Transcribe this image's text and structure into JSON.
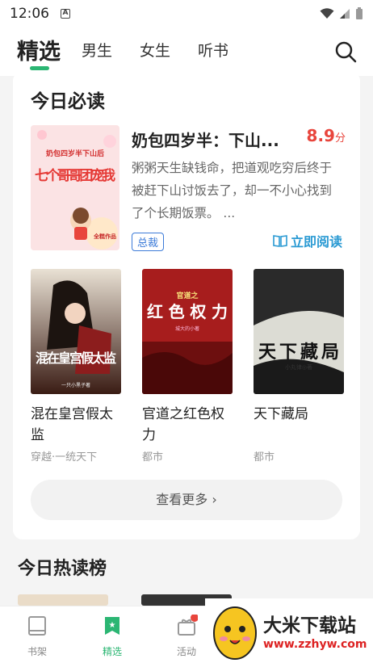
{
  "status_bar": {
    "time": "12:06",
    "a_label": "A"
  },
  "tabs": {
    "items": [
      {
        "label": "精选"
      },
      {
        "label": "男生"
      },
      {
        "label": "女生"
      },
      {
        "label": "听书"
      }
    ]
  },
  "today": {
    "title": "今日必读",
    "feature": {
      "title": "奶包四岁半：下山...",
      "score": "8.9",
      "score_unit": "分",
      "description": "粥粥天生缺钱命，把道观吃穷后终于被赶下山讨饭去了，却一不小心找到了个长期饭票。 ...",
      "tag": "总裁",
      "read_label": "立即阅读",
      "cover_text_top": "奶包四岁半下山后",
      "cover_text_main": "七个哥哥团宠我",
      "cover_badge": "全糕作品"
    },
    "books": [
      {
        "title": "混在皇宫假太监",
        "meta": "穿越·一统天下",
        "cover_text": "混在皇宫假太监",
        "cover_author": "一只小黑子著"
      },
      {
        "title": "官道之红色权力",
        "meta": "都市",
        "cover_text_top": "官道之",
        "cover_text": "红色权力",
        "cover_author": "城大的小著"
      },
      {
        "title": "天下藏局",
        "meta": "都市",
        "cover_text": "天下藏局",
        "cover_author": "小丸律◎著"
      }
    ],
    "more_label": "查看更多"
  },
  "hot": {
    "title": "今日热读榜"
  },
  "bottom_nav": {
    "items": [
      {
        "label": "书架"
      },
      {
        "label": "精选"
      },
      {
        "label": "活动"
      }
    ]
  },
  "watermark": {
    "name": "大米下载站",
    "url": "www.zzhyw.com"
  },
  "colors": {
    "accent": "#2bb673",
    "score": "#e8453c",
    "link": "#2a9ad3"
  }
}
